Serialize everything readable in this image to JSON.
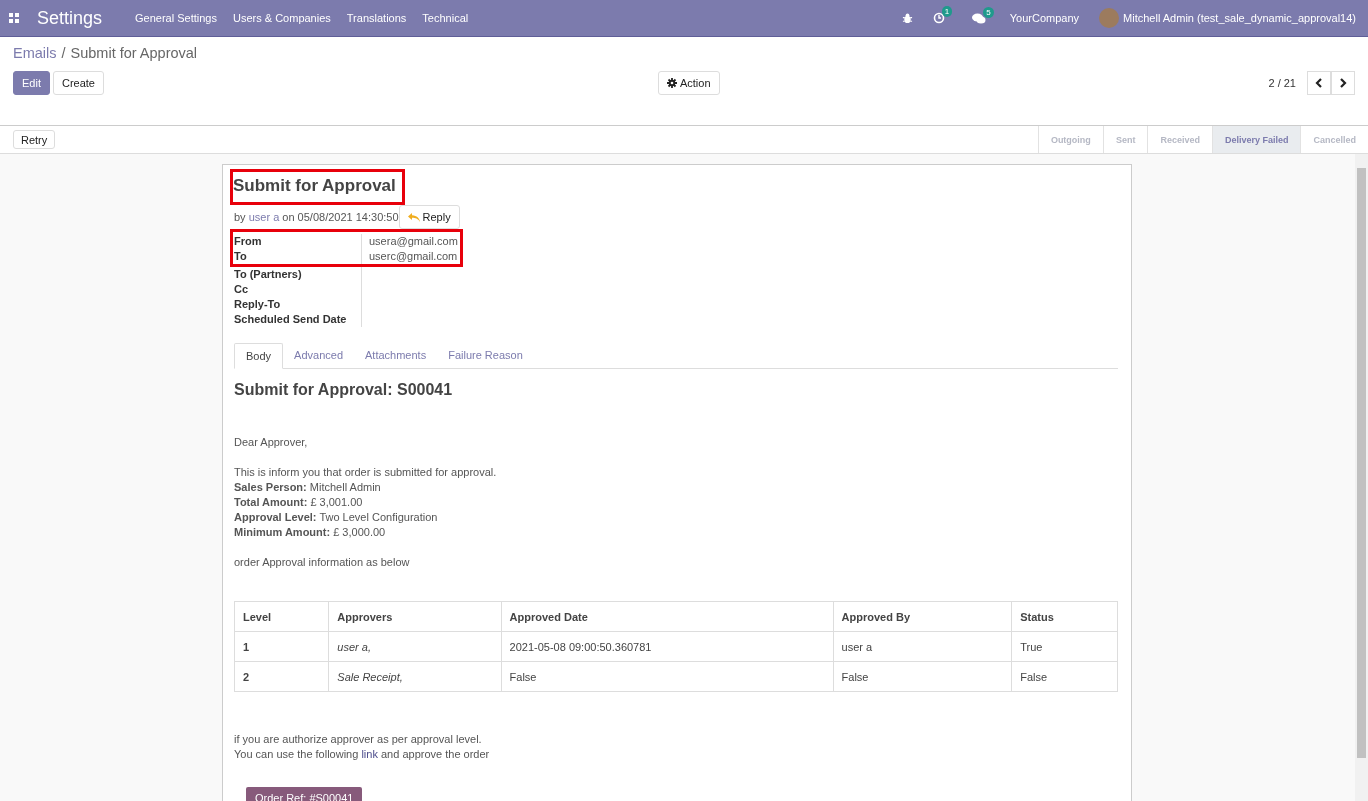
{
  "navbar": {
    "app_title": "Settings",
    "menu": [
      "General Settings",
      "Users & Companies",
      "Translations",
      "Technical"
    ],
    "activity_count": "1",
    "message_count": "5",
    "company": "YourCompany",
    "user": "Mitchell Admin (test_sale_dynamic_approval14)"
  },
  "breadcrumb": {
    "parent": "Emails",
    "separator": "/",
    "current": "Submit for Approval"
  },
  "buttons": {
    "edit": "Edit",
    "create": "Create",
    "action": "Action"
  },
  "pager": {
    "value": "2 / 21"
  },
  "header": {
    "button": "Retry",
    "stages": [
      {
        "label": "Outgoing",
        "selected": false
      },
      {
        "label": "Sent",
        "selected": false
      },
      {
        "label": "Received",
        "selected": false
      },
      {
        "label": "Delivery Failed",
        "selected": true
      },
      {
        "label": "Cancelled",
        "selected": false
      }
    ]
  },
  "message": {
    "title": "Submit for Approval",
    "title_highlighted": true,
    "address_highlighted": true,
    "by": "by",
    "author": "user a",
    "on": "on 05/08/2021 14:30:50",
    "reply": "Reply",
    "fields": [
      {
        "label": "From",
        "value": "usera@gmail.com"
      },
      {
        "label": "To",
        "value": "userc@gmail.com"
      },
      {
        "label": "To (Partners)"
      },
      {
        "label": "Cc"
      },
      {
        "label": "Reply-To"
      },
      {
        "label": "Scheduled Send Date"
      }
    ]
  },
  "tabs": [
    {
      "label": "Body",
      "selected": true
    },
    {
      "label": "Advanced",
      "selected": false
    },
    {
      "label": "Attachments",
      "selected": false
    },
    {
      "label": "Failure Reason",
      "selected": false
    }
  ],
  "body": {
    "heading": "Submit for Approval: S00041",
    "greeting": "Dear Approver,",
    "lines": [
      "This is inform you that order is submitted for approval.",
      "**Sales Person:** Mitchell Admin",
      "**Total Amount:** £ 3,001.00",
      "**Approval Level:** Two Level Configuration",
      "**Minimum Amount:** £ 3,000.00"
    ],
    "intro": "order Approval information as below",
    "table": {
      "columns": [
        "Level",
        "Approvers",
        "Approved Date",
        "Approved By",
        "Status"
      ],
      "rows": [
        [
          "1",
          "user a,",
          "2021-05-08 09:00:50.360781",
          "user a",
          "True"
        ],
        [
          "2",
          "Sale Receipt,",
          "False",
          "False",
          "False"
        ]
      ]
    },
    "outro": "if you are authorize approver as per approval level.",
    "link_line": {
      "before": "You can use the following ",
      "link": "link",
      "after": " and approve the order"
    },
    "order_button": "Order Ref: #S00041"
  }
}
